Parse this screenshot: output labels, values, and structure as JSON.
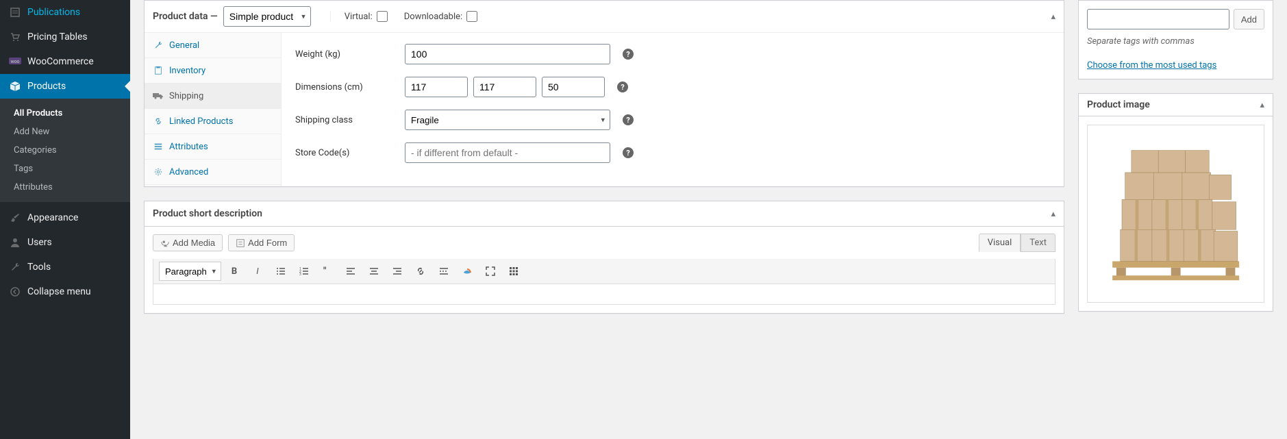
{
  "sidebar": {
    "items": [
      {
        "label": "Publications",
        "icon": "page"
      },
      {
        "label": "Pricing Tables",
        "icon": "cart"
      },
      {
        "label": "WooCommerce",
        "icon": "woo"
      },
      {
        "label": "Products",
        "icon": "package",
        "active": true
      },
      {
        "label": "Appearance",
        "icon": "brush"
      },
      {
        "label": "Users",
        "icon": "user"
      },
      {
        "label": "Tools",
        "icon": "wrench"
      },
      {
        "label": "Collapse menu",
        "icon": "collapse"
      }
    ],
    "submenu": [
      {
        "label": "All Products",
        "current": true
      },
      {
        "label": "Add New"
      },
      {
        "label": "Categories"
      },
      {
        "label": "Tags"
      },
      {
        "label": "Attributes"
      }
    ]
  },
  "product_data": {
    "title": "Product data —",
    "type": "Simple product",
    "virtual_label": "Virtual:",
    "downloadable_label": "Downloadable:",
    "tabs": [
      {
        "label": "General",
        "icon": "wrench"
      },
      {
        "label": "Inventory",
        "icon": "clipboard"
      },
      {
        "label": "Shipping",
        "icon": "truck",
        "active": true
      },
      {
        "label": "Linked Products",
        "icon": "link"
      },
      {
        "label": "Attributes",
        "icon": "list"
      },
      {
        "label": "Advanced",
        "icon": "gear"
      }
    ],
    "fields": {
      "weight_label": "Weight (kg)",
      "weight_value": "100",
      "dimensions_label": "Dimensions (cm)",
      "dim_l": "117",
      "dim_w": "117",
      "dim_h": "50",
      "shipping_class_label": "Shipping class",
      "shipping_class_value": "Fragile",
      "store_codes_label": "Store Code(s)",
      "store_codes_placeholder": "- if different from default -"
    }
  },
  "short_desc": {
    "title": "Product short description",
    "add_media": "Add Media",
    "add_form": "Add Form",
    "visual": "Visual",
    "text": "Text",
    "format": "Paragraph"
  },
  "tags": {
    "add": "Add",
    "howto": "Separate tags with commas",
    "choose": "Choose from the most used tags"
  },
  "product_image": {
    "title": "Product image"
  }
}
